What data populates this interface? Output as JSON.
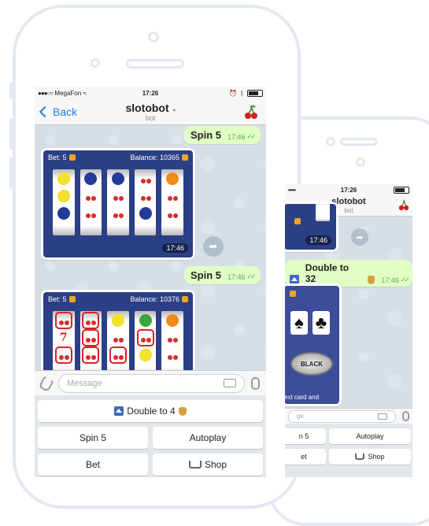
{
  "front": {
    "status": {
      "carrier": "MegaFon",
      "time": "17:26"
    },
    "nav": {
      "back_label": "Back",
      "title": "slotobot",
      "subtitle": "bot"
    },
    "messages": [
      {
        "text": "Spin 5",
        "time": "17:46"
      },
      {
        "text": "Spin 5",
        "time": "17:46"
      }
    ],
    "slot1": {
      "bet_label": "Bet: 5",
      "balance_label": "Balance: 10365",
      "time": "17:46"
    },
    "slot2": {
      "bet_label": "Bet: 5",
      "balance_label": "Balance: 10376"
    },
    "input": {
      "placeholder": "Message"
    },
    "keyboard": {
      "double": "Double to 4",
      "spin": "Spin 5",
      "autoplay": "Autoplay",
      "bet": "Bet",
      "shop": "Shop"
    }
  },
  "back": {
    "status": {
      "time": "17:26"
    },
    "nav": {
      "title": "slotobot",
      "subtitle": "bot"
    },
    "timestamp": "17:46",
    "message": {
      "text": "Double to 32",
      "time": "17:46"
    },
    "card_footer": "ext card and",
    "black_label": "BLACK",
    "keyboard": {
      "spin": "n 5",
      "autoplay": "Autoplay",
      "bet": "et",
      "shop": "Shop"
    }
  },
  "icons": [
    "back-chevron",
    "cherry",
    "share",
    "attach",
    "keyboard",
    "microphone",
    "up-arrow",
    "money-bag",
    "shopping-cart"
  ],
  "colors": {
    "outgoing_bubble": "#e1fec6",
    "link": "#1a7fe8",
    "slot_bg": "#2b3f86",
    "phone_outline": "#e3e8f2"
  }
}
